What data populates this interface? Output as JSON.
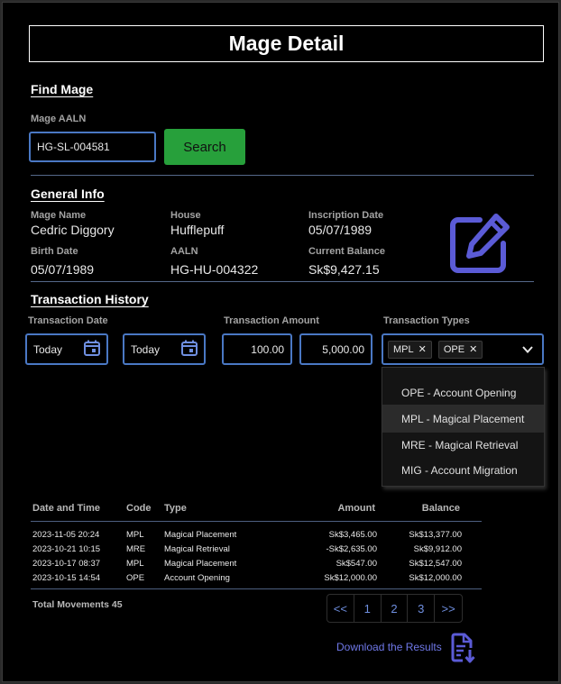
{
  "page": {
    "title": "Mage Detail"
  },
  "find": {
    "section_title": "Find Mage",
    "aaln_label": "Mage AALN",
    "aaln_value": "HG-SL-004581",
    "search_label": "Search"
  },
  "general": {
    "section_title": "General Info",
    "fields": [
      {
        "label": "Mage Name",
        "value": "Cedric Diggory"
      },
      {
        "label": "House",
        "value": "Hufflepuff"
      },
      {
        "label": "Inscription Date",
        "value": "05/07/1989"
      },
      {
        "label": "Birth Date",
        "value": "05/07/1989"
      },
      {
        "label": "AALN",
        "value": "HG-HU-004322"
      },
      {
        "label": "Current Balance",
        "value": "Sk$9,427.15"
      }
    ],
    "edit_icon": "edit-icon",
    "accent_color": "#5b5bd6"
  },
  "history": {
    "section_title": "Transaction History",
    "date_label": "Transaction Date",
    "amount_label": "Transaction Amount",
    "types_label": "Transaction Types",
    "date_from": "Today",
    "date_to": "Today",
    "amount_min": "100.00",
    "amount_max": "5,000.00",
    "selected_types": [
      "MPL",
      "OPE"
    ],
    "type_options": [
      "OPE - Account Opening",
      "MPL - Magical Placement",
      "MRE - Magical Retrieval",
      "MIG - Account Migration"
    ],
    "highlighted_option": "MPL - Magical Placement",
    "table": {
      "headers": [
        "Date and Time",
        "Code",
        "Type",
        "Amount",
        "Balance"
      ],
      "rows": [
        [
          "2023-11-05 20:24",
          "MPL",
          "Magical Placement",
          "Sk$3,465.00",
          "Sk$13,377.00"
        ],
        [
          "2023-10-21 10:15",
          "MRE",
          "Magical Retrieval",
          "-Sk$2,635.00",
          "Sk$9,912.00"
        ],
        [
          "2023-10-17 08:37",
          "MPL",
          "Magical Placement",
          "Sk$547.00",
          "Sk$12,547.00"
        ],
        [
          "2023-10-15 14:54",
          "OPE",
          "Account Opening",
          "Sk$12,000.00",
          "Sk$12,000.00"
        ]
      ]
    },
    "total_movements": "Total Movements 45",
    "pager": [
      "<<",
      "1",
      "2",
      "3",
      ">>"
    ],
    "download_label": "Download the Results",
    "download_icon": "file-download-icon"
  }
}
